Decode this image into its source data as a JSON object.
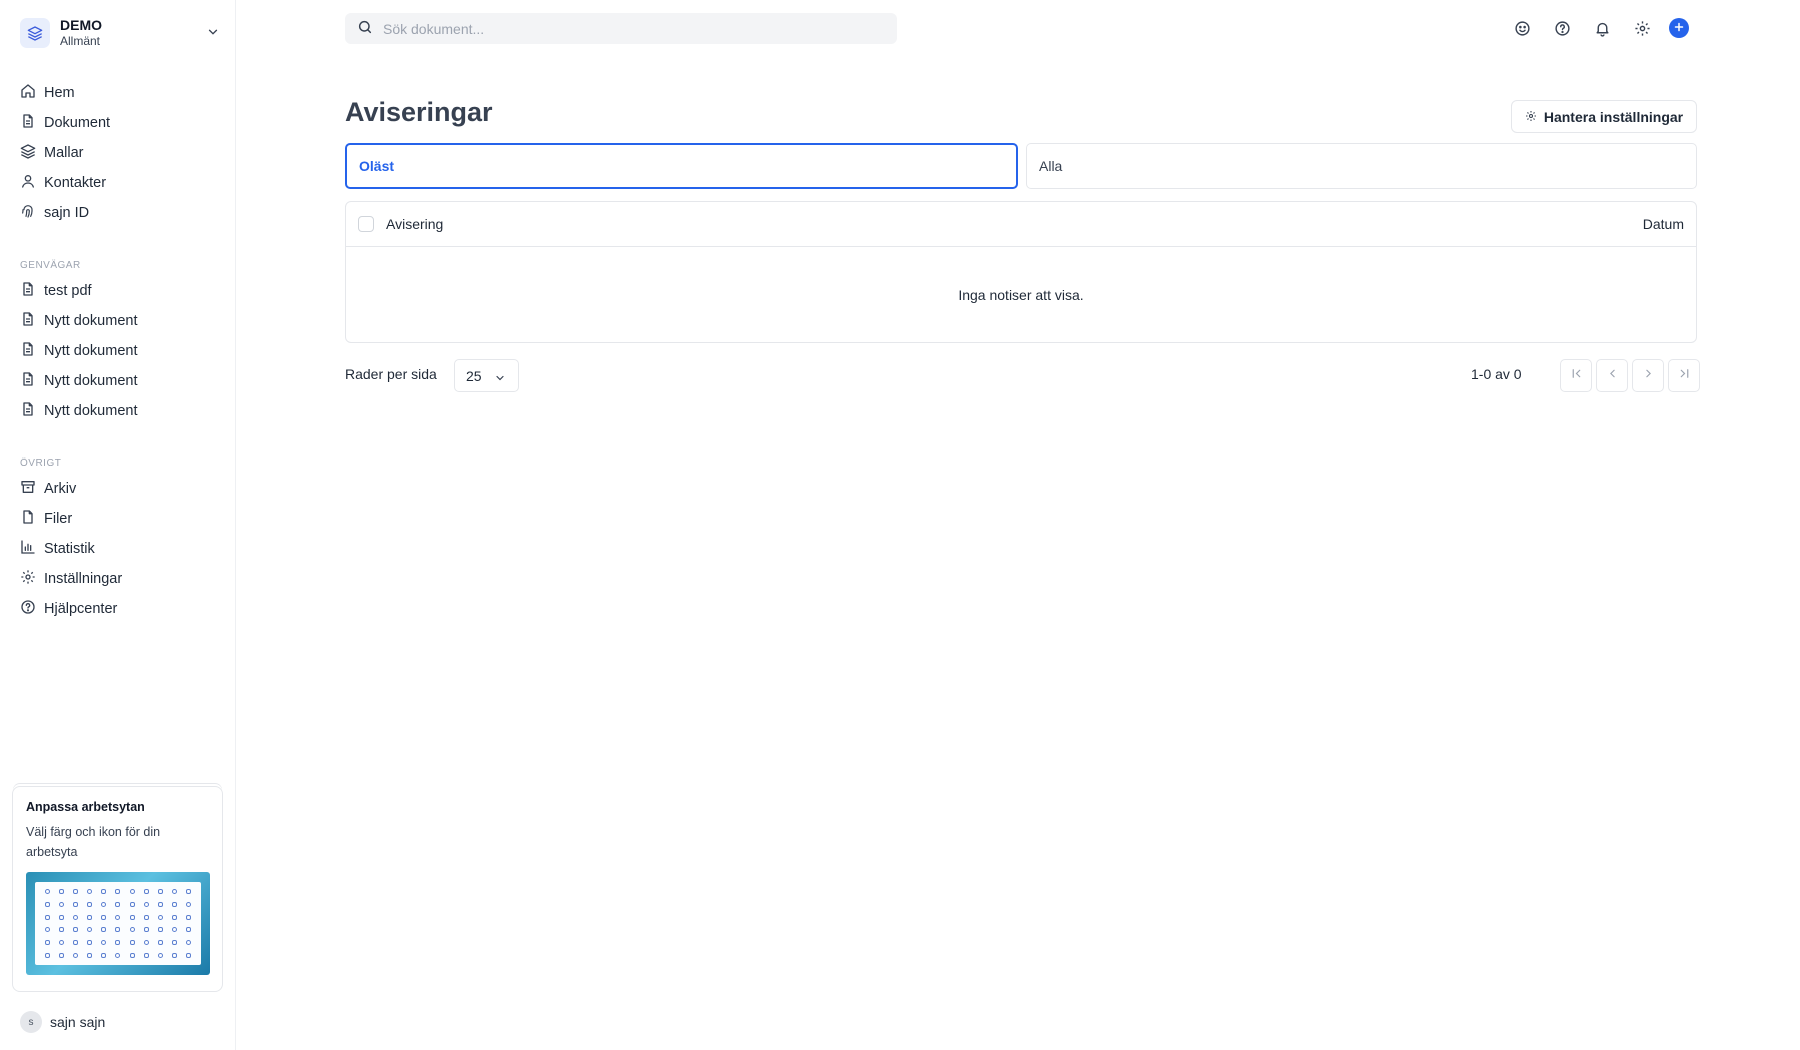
{
  "workspace": {
    "name": "DEMO",
    "subtitle": "Allmänt"
  },
  "nav_main": [
    {
      "label": "Hem",
      "icon": "home-icon"
    },
    {
      "label": "Dokument",
      "icon": "document-icon"
    },
    {
      "label": "Mallar",
      "icon": "layers-icon"
    },
    {
      "label": "Kontakter",
      "icon": "user-icon"
    },
    {
      "label": "sajn ID",
      "icon": "fingerprint-icon"
    }
  ],
  "shortcuts": {
    "title": "GENVÄGAR",
    "items": [
      {
        "label": "test pdf"
      },
      {
        "label": "Nytt dokument"
      },
      {
        "label": "Nytt dokument"
      },
      {
        "label": "Nytt dokument"
      },
      {
        "label": "Nytt dokument"
      }
    ]
  },
  "other": {
    "title": "ÖVRIGT",
    "items": [
      {
        "label": "Arkiv",
        "icon": "archive-icon"
      },
      {
        "label": "Filer",
        "icon": "file-icon"
      },
      {
        "label": "Statistik",
        "icon": "bar-chart-icon"
      },
      {
        "label": "Inställningar",
        "icon": "gear-icon"
      },
      {
        "label": "Hjälpcenter",
        "icon": "help-circle-icon"
      }
    ]
  },
  "promo": {
    "title": "Anpassa arbetsytan",
    "body": "Välj färg och ikon för din arbetsyta"
  },
  "user": {
    "initial": "s",
    "name": "sajn sajn"
  },
  "search": {
    "placeholder": "Sök dokument..."
  },
  "page": {
    "title": "Aviseringar",
    "manage_button": "Hantera inställningar",
    "tabs": [
      {
        "label": "Oläst",
        "active": true
      },
      {
        "label": "Alla",
        "active": false
      }
    ]
  },
  "table": {
    "columns": [
      "Avisering",
      "Datum"
    ],
    "empty_text": "Inga notiser att visa."
  },
  "pagination": {
    "rows_label": "Rader per sida",
    "rows_value": "25",
    "info": "1-0 av 0"
  },
  "colors": {
    "accent": "#2563eb",
    "border": "#e5e7eb",
    "muted": "#9ca3af"
  }
}
